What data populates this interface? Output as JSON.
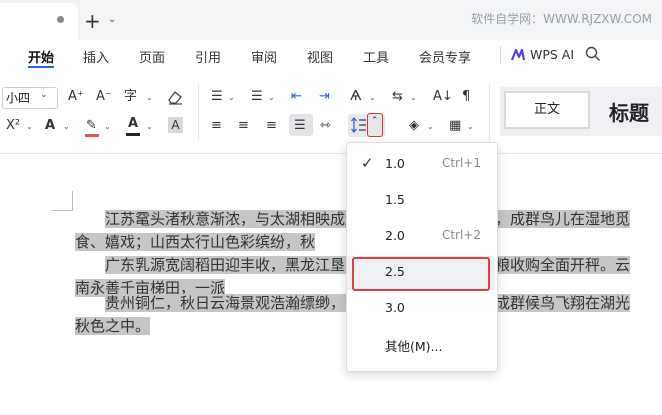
{
  "watermark": "软件自学网：WWW.RJZXW.COM",
  "titlebar": {
    "new_tab_icon": "+",
    "chevron": "⌄"
  },
  "menubar": {
    "tabs": [
      "开始",
      "插入",
      "页面",
      "引用",
      "审阅",
      "视图",
      "工具",
      "会员专享"
    ],
    "active": "开始",
    "wps_ai": "WPS AI",
    "accent": "#2b64e8"
  },
  "ribbon": {
    "font_size": "小四",
    "style_normal": "正文",
    "style_heading": "标题",
    "icons": [
      "grow-font-icon",
      "shrink-font-icon",
      "phonetic-icon",
      "eraser-icon",
      "bullets-icon",
      "numbering-icon",
      "decrease-indent-icon",
      "increase-indent-icon",
      "chinese-layout-icon",
      "text-direction-icon",
      "sort-icon",
      "show-marks-icon",
      "superscript-icon",
      "text-effect-icon",
      "highlight-icon",
      "font-color-icon",
      "char-shading-icon",
      "align-left-icon",
      "align-center-icon",
      "align-right-icon",
      "justify-icon",
      "distributed-icon",
      "line-spacing-icon",
      "shading-icon",
      "border-icon"
    ]
  },
  "document": {
    "paragraphs": [
      "江苏鼋头渚秋意渐浓，与太湖相映成趣，芦苇荡中一片金黄，成群鸟儿在湿地觅食、嬉戏；山西太行山色彩缤纷，秋",
      "广东乳源宽阔稻田迎丰收，黑龙江垦区田野上机器轰鸣，秋粮收购全面开秤。云南永善千亩梯田，一派",
      "贵州铜仁，秋日云海景观浩瀚缥缈，湖光山色间波光粼粼，成群候鸟飞翔在湖光秋色之中。"
    ],
    "highlight_color": "#c6c6c6"
  },
  "line_spacing_menu": {
    "options": [
      {
        "label": "1.0",
        "shortcut": "Ctrl+1",
        "checked": true
      },
      {
        "label": "1.5",
        "shortcut": "",
        "checked": false
      },
      {
        "label": "2.0",
        "shortcut": "Ctrl+2",
        "checked": false
      },
      {
        "label": "2.5",
        "shortcut": "",
        "checked": false
      },
      {
        "label": "3.0",
        "shortcut": "",
        "checked": false
      },
      {
        "label": "其他(M)...",
        "shortcut": "",
        "checked": false
      }
    ],
    "check_glyph": "✓",
    "highlighted_option": "2.5",
    "highlight_border": "#e23c46"
  }
}
